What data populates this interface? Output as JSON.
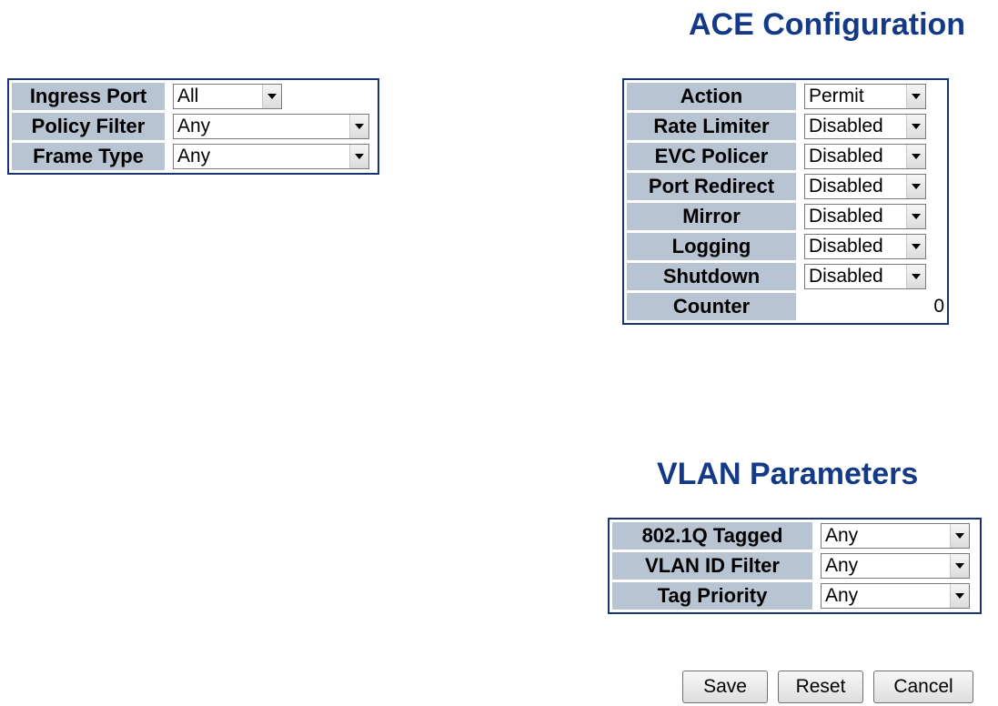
{
  "ace_configuration": {
    "title": "ACE Configuration",
    "action": {
      "label": "Action",
      "value": "Permit"
    },
    "rate_limiter": {
      "label": "Rate Limiter",
      "value": "Disabled"
    },
    "evc_policer": {
      "label": "EVC Policer",
      "value": "Disabled"
    },
    "port_redirect": {
      "label": "Port Redirect",
      "value": "Disabled"
    },
    "mirror": {
      "label": "Mirror",
      "value": "Disabled"
    },
    "logging": {
      "label": "Logging",
      "value": "Disabled"
    },
    "shutdown": {
      "label": "Shutdown",
      "value": "Disabled"
    },
    "counter": {
      "label": "Counter",
      "value": "0"
    }
  },
  "ingress": {
    "ingress_port": {
      "label": "Ingress Port",
      "value": "All"
    },
    "policy_filter": {
      "label": "Policy Filter",
      "value": "Any"
    },
    "frame_type": {
      "label": "Frame Type",
      "value": "Any"
    }
  },
  "vlan_parameters": {
    "title": "VLAN Parameters",
    "tagged_8021q": {
      "label": "802.1Q Tagged",
      "value": "Any"
    },
    "vlan_id_filter": {
      "label": "VLAN ID Filter",
      "value": "Any"
    },
    "tag_priority": {
      "label": "Tag Priority",
      "value": "Any"
    }
  },
  "buttons": {
    "save": "Save",
    "reset": "Reset",
    "cancel": "Cancel"
  },
  "colors": {
    "title": "#143a87",
    "label_cell": "#b8c4d2",
    "table_border": "#1a3373"
  },
  "icons": {
    "dropdown_arrow": "chevron-down-icon"
  }
}
